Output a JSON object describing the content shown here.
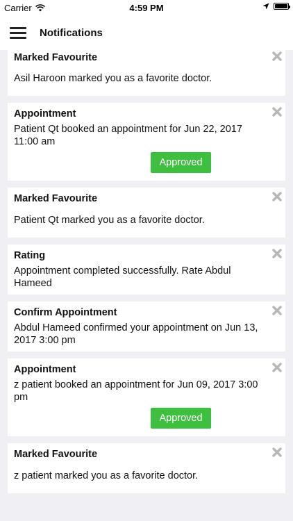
{
  "status_bar": {
    "carrier": "Carrier",
    "time": "4:59 PM"
  },
  "header": {
    "title": "Notifications",
    "menu_icon": "hamburger-menu-icon"
  },
  "notifications": [
    {
      "title": "Marked Favourite",
      "body": "Asil Haroon marked you as a favorite doctor."
    },
    {
      "title": "Appointment",
      "body": "Patient Qt booked an appointment for Jun 22, 2017 11:00 am",
      "status": "Approved"
    },
    {
      "title": "Marked Favourite",
      "body": "Patient Qt marked you as a favorite doctor."
    },
    {
      "title": "Rating",
      "body": "Appointment completed successfully. Rate Abdul Hameed"
    },
    {
      "title": "Confirm Appointment",
      "body": "Abdul Hameed confirmed your appointment on Jun 13, 2017 3:00 pm"
    },
    {
      "title": "Appointment",
      "body": "z patient booked an appointment for Jun 09, 2017 3:00 pm",
      "status": "Approved"
    },
    {
      "title": "Marked Favourite",
      "body": "z patient marked you as a favorite doctor."
    }
  ],
  "colors": {
    "approved": "#3fbf3f",
    "background": "#efeff4",
    "close_icon": "#b7b7b7"
  }
}
